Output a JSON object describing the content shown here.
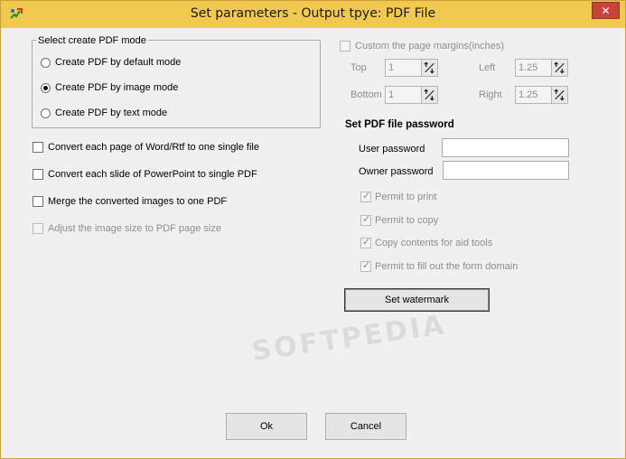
{
  "window": {
    "title": "Set parameters - Output tpye: PDF File",
    "close_glyph": "✕"
  },
  "mode_group": {
    "label": "Select create PDF mode",
    "options": [
      {
        "label": "Create PDF by default mode",
        "selected": false
      },
      {
        "label": "Create PDF by image mode",
        "selected": true
      },
      {
        "label": "Create PDF by text mode",
        "selected": false
      }
    ]
  },
  "options": [
    {
      "label": "Convert each page of Word/Rtf to one single file",
      "checked": false,
      "enabled": true
    },
    {
      "label": "Convert each slide of PowerPoint to single PDF",
      "checked": false,
      "enabled": true
    },
    {
      "label": "Merge the converted images to one PDF",
      "checked": false,
      "enabled": true
    },
    {
      "label": "Adjust the image size to PDF page size",
      "checked": false,
      "enabled": false
    }
  ],
  "margins": {
    "label": "Custom the page margins(inches)",
    "checked": false,
    "top": {
      "label": "Top",
      "value": "1"
    },
    "left": {
      "label": "Left",
      "value": "1.25"
    },
    "bottom": {
      "label": "Bottom",
      "value": "1"
    },
    "right": {
      "label": "Right",
      "value": "1.25"
    }
  },
  "password": {
    "heading": "Set PDF file password",
    "user_label": "User password",
    "user_value": "",
    "owner_label": "Owner password",
    "owner_value": "",
    "permissions": [
      {
        "label": "Permit to print",
        "checked": true
      },
      {
        "label": "Permit to copy",
        "checked": true
      },
      {
        "label": "Copy contents for aid tools",
        "checked": true
      },
      {
        "label": "Permit to fill out the form domain",
        "checked": true
      }
    ],
    "watermark_button": "Set watermark"
  },
  "buttons": {
    "ok": "Ok",
    "cancel": "Cancel"
  },
  "watermark_overlay": "SOFTPEDIA",
  "colors": {
    "titlebar": "#f1c94f",
    "close": "#c7443a",
    "dialog": "#f0f0f0"
  }
}
